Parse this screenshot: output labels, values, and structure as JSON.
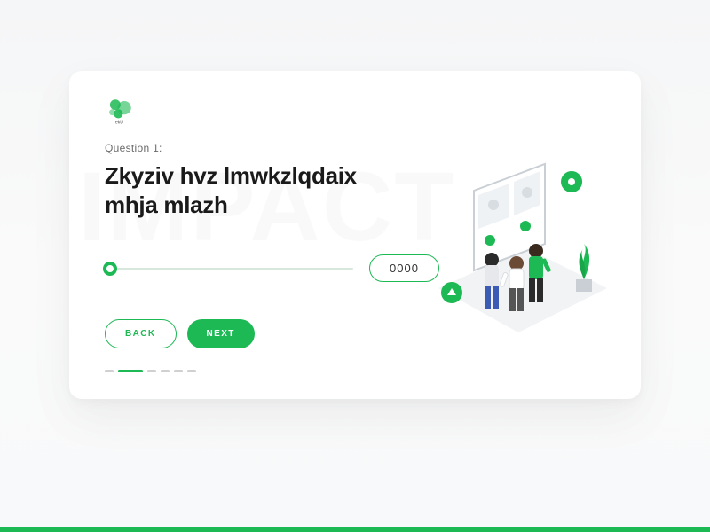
{
  "brand": {
    "name": "ekU"
  },
  "watermark": "IMPACT",
  "question": {
    "label": "Question 1:",
    "title_line1": "Zkyziv hvz lmwkzlqdaix",
    "title_line2": "mhja mlazh"
  },
  "slider": {
    "value_display": "0000"
  },
  "buttons": {
    "back": "BACK",
    "next": "NEXT"
  },
  "progress": {
    "total": 6,
    "active_index": 1
  },
  "colors": {
    "accent": "#1db954"
  }
}
